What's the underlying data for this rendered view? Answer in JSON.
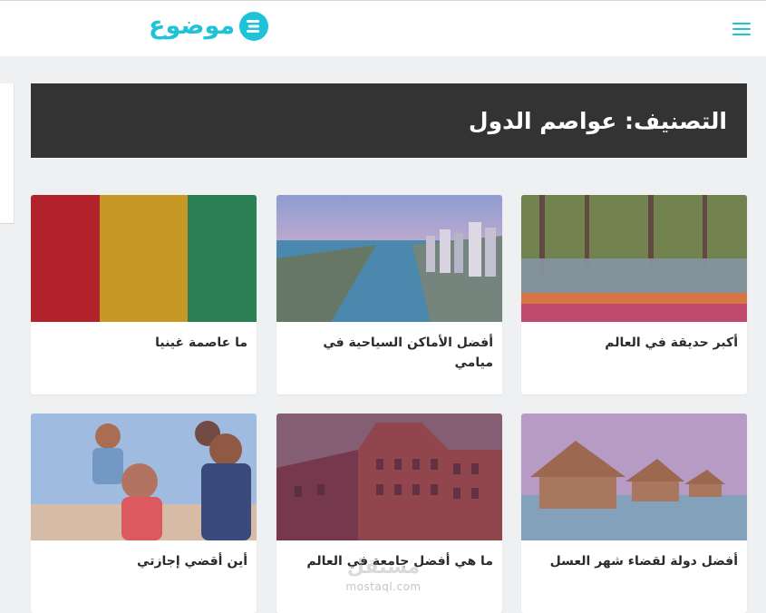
{
  "header": {
    "logo_text": "موضوع",
    "logo_icon": "mawdoo-logo-icon",
    "menu_icon": "hamburger-menu-icon",
    "accent_color": "#1ec3d8"
  },
  "page": {
    "category_title": "التصنيف: عواصم الدول"
  },
  "articles": [
    {
      "title": "ما عاصمة غينيا",
      "image": "guinea-flag"
    },
    {
      "title": "أفضل الأماكن السياحية في ميامي",
      "image": "miami-aerial"
    },
    {
      "title": "أكبر حديقة في العالم",
      "image": "tulip-garden"
    },
    {
      "title": "أين أقضي إجازتي",
      "image": "family-vacation"
    },
    {
      "title": "ما هي أفضل جامعة في العالم",
      "image": "university-building"
    },
    {
      "title": "أفضل دولة لقضاء شهر العسل",
      "image": "overwater-bungalows"
    }
  ],
  "watermark": {
    "logo": "مستقل",
    "text": "mostaql.com"
  }
}
